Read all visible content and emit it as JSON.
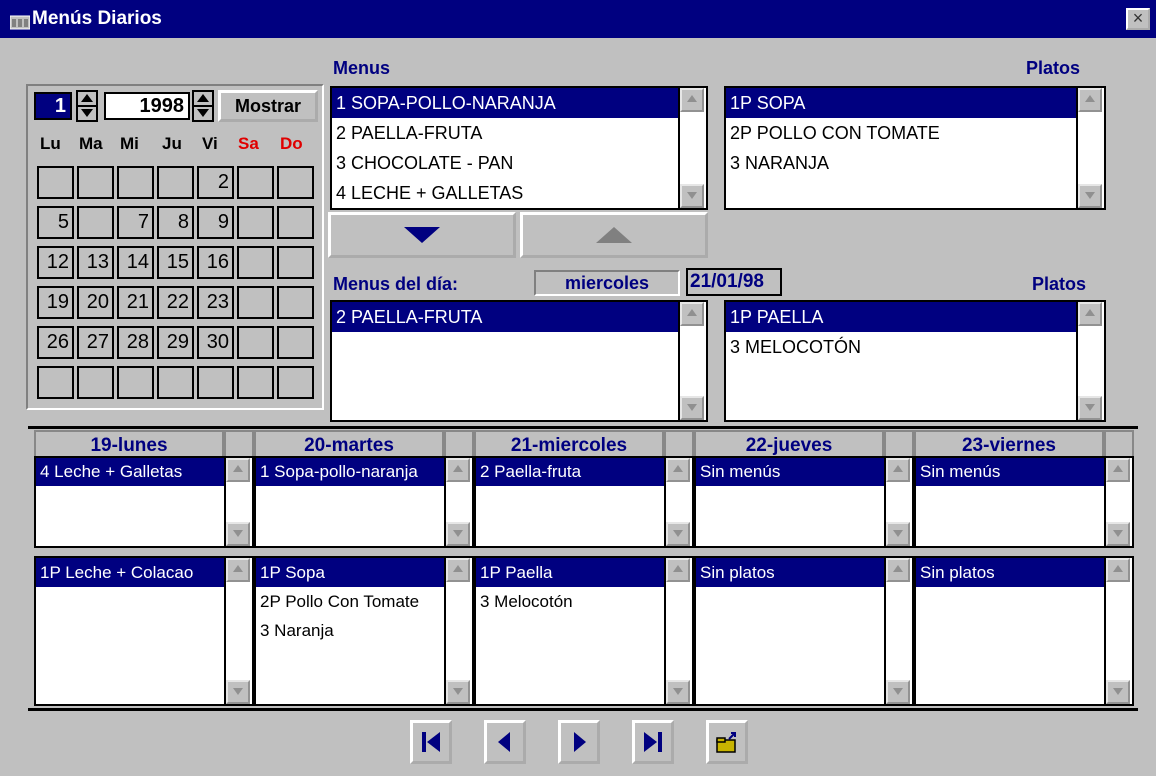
{
  "window": {
    "title": "Menús Diarios",
    "close_label": "×"
  },
  "calendar": {
    "month": "1",
    "year": "1998",
    "show_button": "Mostrar",
    "weekdays": [
      "Lu",
      "Ma",
      "Mi",
      "Ju",
      "Vi",
      "Sa",
      "Do"
    ],
    "weeks": [
      [
        "",
        "",
        "",
        "",
        "2",
        "",
        ""
      ],
      [
        "5",
        "",
        "7",
        "8",
        "9",
        "",
        ""
      ],
      [
        "12",
        "13",
        "14",
        "15",
        "16",
        "",
        ""
      ],
      [
        "19",
        "20",
        "21",
        "22",
        "23",
        "",
        ""
      ],
      [
        "26",
        "27",
        "28",
        "29",
        "30",
        "",
        ""
      ],
      [
        "",
        "",
        "",
        "",
        "",
        "",
        ""
      ]
    ]
  },
  "menus": {
    "label": "Menus",
    "items": [
      "1   SOPA-POLLO-NARANJA",
      "2   PAELLA-FRUTA",
      "3   CHOCOLATE - PAN",
      "4   LECHE + GALLETAS"
    ]
  },
  "platos": {
    "label": "Platos",
    "items": [
      "1P SOPA",
      "2P POLLO CON TOMATE",
      "3 NARANJA"
    ]
  },
  "menus_dia": {
    "label": "Menus del día:",
    "weekday": "miercoles",
    "date": "21/01/98",
    "items": [
      "2   PAELLA-FRUTA"
    ]
  },
  "platos_dia": {
    "label": "Platos",
    "items": [
      "1P PAELLA",
      "3 MELOCOTÓN"
    ]
  },
  "week": [
    {
      "header": "19-lunes",
      "menus": [
        "4   Leche + Galletas"
      ],
      "platos": [
        "1P Leche + Colacao"
      ]
    },
    {
      "header": "20-martes",
      "menus": [
        "1   Sopa-pollo-naranja"
      ],
      "platos": [
        "1P Sopa",
        "2P Pollo Con Tomate",
        "3  Naranja"
      ]
    },
    {
      "header": "21-miercoles",
      "menus": [
        "2   Paella-fruta"
      ],
      "platos": [
        "1P Paella",
        "3  Melocotón"
      ]
    },
    {
      "header": "22-jueves",
      "menus": [
        "Sin menús"
      ],
      "platos": [
        "Sin platos"
      ]
    },
    {
      "header": "23-viernes",
      "menus": [
        "Sin menús"
      ],
      "platos": [
        "Sin platos"
      ]
    }
  ],
  "colors": {
    "selection": "#000080",
    "weekend": "#e00000",
    "face": "#c0c0c0"
  }
}
